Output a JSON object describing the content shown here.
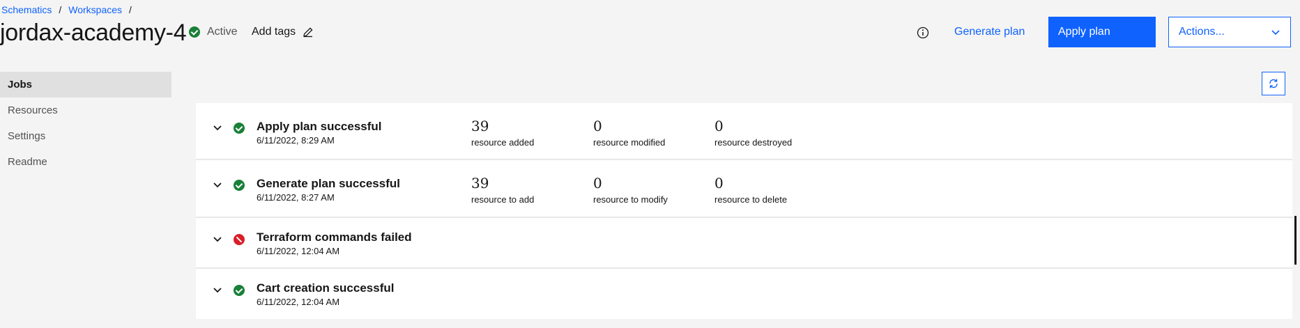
{
  "breadcrumb": {
    "items": [
      "Schematics",
      "Workspaces"
    ],
    "sep": "/"
  },
  "workspace": {
    "title": "jordax-academy-4",
    "status": "Active",
    "add_tags": "Add tags"
  },
  "toolbar": {
    "generate_plan": "Generate plan",
    "apply_plan": "Apply plan",
    "actions": "Actions..."
  },
  "sidebar": {
    "items": [
      {
        "label": "Jobs"
      },
      {
        "label": "Resources"
      },
      {
        "label": "Settings"
      },
      {
        "label": "Readme"
      }
    ]
  },
  "jobs": [
    {
      "title": "Apply plan successful",
      "date": "6/11/2022, 8:29 AM",
      "status": "success",
      "stats": [
        {
          "value": "39",
          "label": "resource added"
        },
        {
          "value": "0",
          "label": "resource modified"
        },
        {
          "value": "0",
          "label": "resource destroyed"
        }
      ]
    },
    {
      "title": "Generate plan successful",
      "date": "6/11/2022, 8:27 AM",
      "status": "success",
      "stats": [
        {
          "value": "39",
          "label": "resource to add"
        },
        {
          "value": "0",
          "label": "resource to modify"
        },
        {
          "value": "0",
          "label": "resource to delete"
        }
      ]
    },
    {
      "title": "Terraform commands failed",
      "date": "6/11/2022, 12:04 AM",
      "status": "failed"
    },
    {
      "title": "Cart creation successful",
      "date": "6/11/2022, 12:04 AM",
      "status": "success"
    }
  ],
  "colors": {
    "primary": "#0f62fe",
    "success": "#198038",
    "error": "#da1e28"
  },
  "icons": {
    "status": "checkmark-filled-icon",
    "edit": "pencil-icon",
    "info": "information-icon",
    "refresh": "refresh-icon",
    "expand": "chevron-down-icon",
    "failed": "misuse-icon"
  }
}
